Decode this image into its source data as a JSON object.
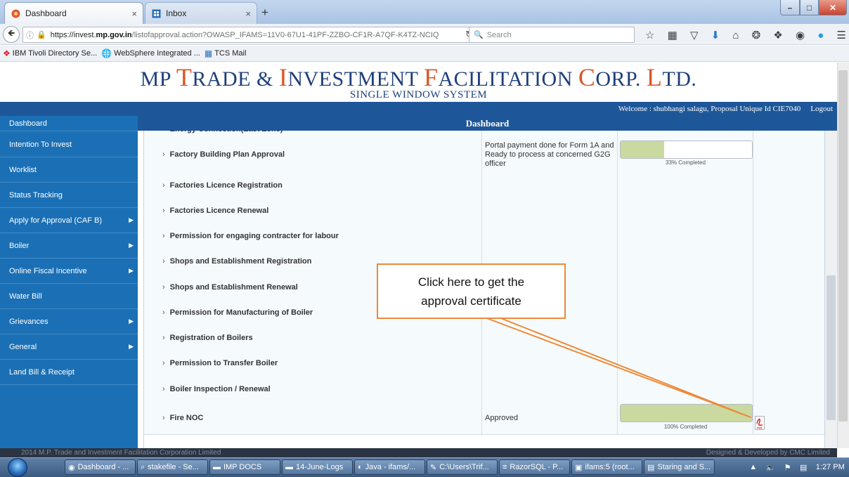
{
  "browser": {
    "tabs": [
      {
        "label": "Dashboard",
        "icon": "flower-icon"
      },
      {
        "label": "Inbox",
        "icon": "mail-grid-icon"
      }
    ],
    "tab_close": "×",
    "new_tab": "+",
    "url": {
      "prefix": "https://invest.",
      "host": "mp.gov.in",
      "path": "/listofapproval.action?OWASP_IFAMS=11V0-67U1-41PF-ZZBO-CF1R-A7QF-K4TZ-NCIQ"
    },
    "search_placeholder": "Search",
    "bookmarks": [
      {
        "label": "IBM Tivoli Directory Se...",
        "icon": "ibm-icon"
      },
      {
        "label": "WebSphere Integrated ...",
        "icon": "globe-icon"
      },
      {
        "label": "TCS Mail",
        "icon": "mail-grid-icon"
      }
    ]
  },
  "header": {
    "title_parts": [
      "MP ",
      "T",
      "RADE & ",
      "I",
      "NVESTMENT ",
      "F",
      "ACILITATION ",
      "C",
      "ORP. ",
      "L",
      "TD."
    ],
    "subtitle": "SINGLE WINDOW SYSTEM",
    "welcome": "Welcome  :  shubhangi salagu, Proposal Unique Id CIE7040",
    "logout": "Logout"
  },
  "sidebar": {
    "items": [
      {
        "label": "Dashboard",
        "arrow": false
      },
      {
        "label": "Intention To Invest",
        "arrow": false
      },
      {
        "label": "Worklist",
        "arrow": false
      },
      {
        "label": "Status Tracking",
        "arrow": false
      },
      {
        "label": "Apply for Approval (CAF B)",
        "arrow": true
      },
      {
        "label": "Boiler",
        "arrow": true
      },
      {
        "label": "Online Fiscal Incentive",
        "arrow": true
      },
      {
        "label": "Water Bill",
        "arrow": false
      },
      {
        "label": "Grievances",
        "arrow": true
      },
      {
        "label": "General",
        "arrow": true
      },
      {
        "label": "Land Bill & Receipt",
        "arrow": false
      }
    ]
  },
  "main": {
    "heading": "Dashboard",
    "rows": [
      {
        "name": "Energy Connection(East Zone)",
        "status": "",
        "progress": null,
        "progress_label": ""
      },
      {
        "name": "Factory Building Plan Approval",
        "status": "Portal payment done for Form 1A and Ready to process at concerned G2G officer",
        "progress": 33,
        "progress_label": "33% Completed"
      },
      {
        "name": "Factories Licence Registration",
        "status": "",
        "progress": null,
        "progress_label": ""
      },
      {
        "name": "Factories Licence Renewal",
        "status": "",
        "progress": null,
        "progress_label": ""
      },
      {
        "name": "Permission for engaging contracter for labour",
        "status": "",
        "progress": null,
        "progress_label": ""
      },
      {
        "name": "Shops and Establishment Registration",
        "status": "",
        "progress": null,
        "progress_label": ""
      },
      {
        "name": "Shops and Establishment Renewal",
        "status": "",
        "progress": null,
        "progress_label": ""
      },
      {
        "name": "Permission for Manufacturing of Boiler",
        "status": "",
        "progress": null,
        "progress_label": ""
      },
      {
        "name": "Registration of Boilers",
        "status": "",
        "progress": null,
        "progress_label": ""
      },
      {
        "name": "Permission to Transfer Boiler",
        "status": "",
        "progress": null,
        "progress_label": ""
      },
      {
        "name": "Boiler Inspection / Renewal",
        "status": "",
        "progress": null,
        "progress_label": ""
      },
      {
        "name": "Fire NOC",
        "status": "Approved",
        "progress": 100,
        "progress_label": "100% Completed"
      }
    ],
    "pdf_icon": "pdf-icon"
  },
  "callout": {
    "line1": "Click here to get the",
    "line2": "approval certificate"
  },
  "footer": {
    "left": "2014 M.P. Trade and Investment Facilitation Corporation Limited",
    "right": "Designed & Developed by CMC Limited"
  },
  "taskbar": {
    "items": [
      {
        "label": "Dashboard - ...",
        "icon": "firefox-icon"
      },
      {
        "label": "stakefile - Se...",
        "icon": "search-icon"
      },
      {
        "label": "IMP DOCS",
        "icon": "folder-icon"
      },
      {
        "label": "14-June-Logs",
        "icon": "folder-icon"
      },
      {
        "label": "Java - ifams/...",
        "icon": "eclipse-icon"
      },
      {
        "label": "C:\\Users\\Trif...",
        "icon": "notepad-icon"
      },
      {
        "label": "RazorSQL - P...",
        "icon": "db-icon"
      },
      {
        "label": "ifams:5 (root...",
        "icon": "terminal-icon"
      },
      {
        "label": "Staring and S...",
        "icon": "document-icon"
      }
    ],
    "time": "1:27 PM"
  },
  "colors": {
    "brand_blue": "#1e3f7a",
    "brand_orange": "#d9572a",
    "sidebar": "#1b70b5",
    "bar": "#1e5799",
    "progress_fill": "#c9d9a0",
    "callout_border": "#ec8a3a"
  }
}
